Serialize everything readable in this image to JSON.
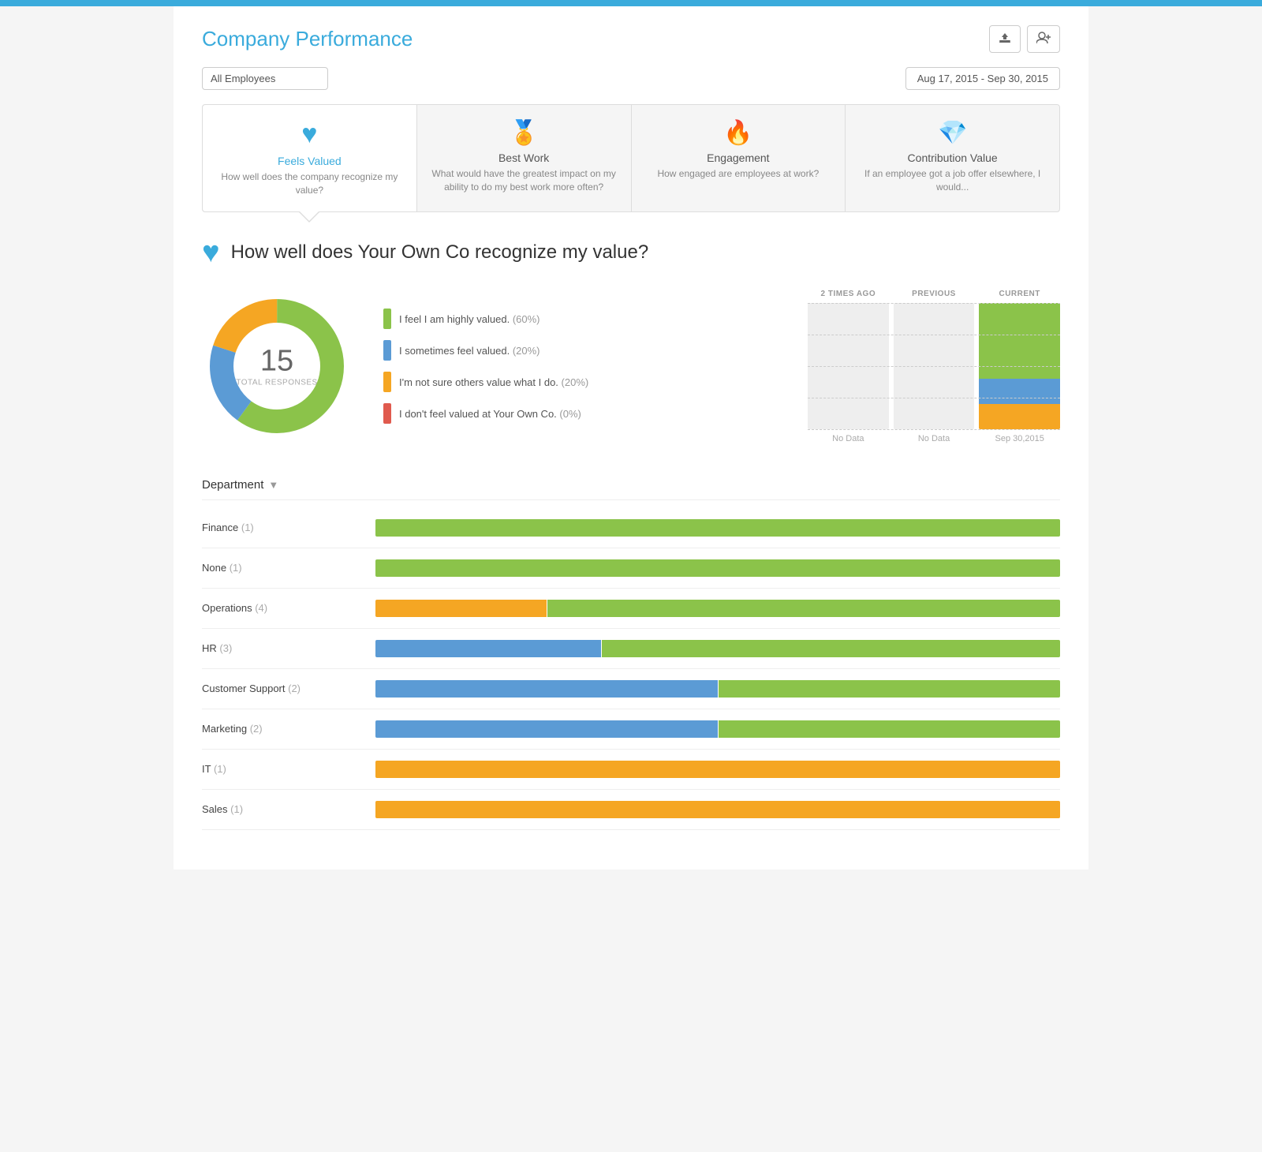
{
  "topBar": {
    "color": "#3aabdc"
  },
  "header": {
    "title": "Company Performance",
    "exportBtn": "⬆",
    "addBtn": "👤+"
  },
  "filters": {
    "employee": "All Employees",
    "dateRange": "Aug 17, 2015 - Sep 30, 2015"
  },
  "tabs": [
    {
      "id": "feels-valued",
      "icon": "♥",
      "iconType": "heart",
      "title": "Feels Valued",
      "desc": "How well does the company recognize my value?",
      "active": true
    },
    {
      "id": "best-work",
      "icon": "🏅",
      "iconType": "badge",
      "title": "Best Work",
      "desc": "What would have the greatest impact on my ability to do my best work more often?",
      "active": false
    },
    {
      "id": "engagement",
      "icon": "🔥",
      "iconType": "flame",
      "title": "Engagement",
      "desc": "How engaged are employees at work?",
      "active": false
    },
    {
      "id": "contribution-value",
      "icon": "💎",
      "iconType": "diamond",
      "title": "Contribution Value",
      "desc": "If an employee got a job offer elsewhere, I would...",
      "active": false
    }
  ],
  "question": {
    "text": "How well does Your Own Co recognize my value?",
    "totalResponses": 15,
    "totalLabel": "TOTAL RESPONSES"
  },
  "donut": {
    "segments": [
      {
        "label": "I feel I am highly valued.",
        "pct": 60,
        "color": "#8bc34a"
      },
      {
        "label": "I sometimes feel valued.",
        "pct": 20,
        "color": "#5b9bd5"
      },
      {
        "label": "I'm not sure others value what I do.",
        "pct": 20,
        "color": "#f5a623"
      },
      {
        "label": "I don't feel valued at Your Own Co.",
        "pct": 0,
        "color": "#e05a4e"
      }
    ]
  },
  "history": {
    "columns": [
      {
        "label": "2 TIMES AGO",
        "dateLabel": "No Data",
        "hasData": false,
        "bars": []
      },
      {
        "label": "PREVIOUS",
        "dateLabel": "No Data",
        "hasData": false,
        "bars": []
      },
      {
        "label": "CURRENT",
        "dateLabel": "Sep 30,2015",
        "hasData": true,
        "bars": [
          {
            "color": "#8bc34a",
            "pct": 60
          },
          {
            "color": "#5b9bd5",
            "pct": 20
          },
          {
            "color": "#f5a623",
            "pct": 20
          }
        ]
      }
    ]
  },
  "department": {
    "label": "Department",
    "rows": [
      {
        "name": "Finance",
        "count": 1,
        "bars": [
          {
            "color": "#8bc34a",
            "pct": 100
          }
        ]
      },
      {
        "name": "None",
        "count": 1,
        "bars": [
          {
            "color": "#8bc34a",
            "pct": 100
          }
        ]
      },
      {
        "name": "Operations",
        "count": 4,
        "bars": [
          {
            "color": "#f5a623",
            "pct": 25
          },
          {
            "color": "#8bc34a",
            "pct": 75
          }
        ]
      },
      {
        "name": "HR",
        "count": 3,
        "bars": [
          {
            "color": "#5b9bd5",
            "pct": 33
          },
          {
            "color": "#8bc34a",
            "pct": 67
          }
        ]
      },
      {
        "name": "Customer Support",
        "count": 2,
        "bars": [
          {
            "color": "#5b9bd5",
            "pct": 50
          },
          {
            "color": "#8bc34a",
            "pct": 50
          }
        ]
      },
      {
        "name": "Marketing",
        "count": 2,
        "bars": [
          {
            "color": "#5b9bd5",
            "pct": 50
          },
          {
            "color": "#8bc34a",
            "pct": 50
          }
        ]
      },
      {
        "name": "IT",
        "count": 1,
        "bars": [
          {
            "color": "#f5a623",
            "pct": 100
          }
        ]
      },
      {
        "name": "Sales",
        "count": 1,
        "bars": [
          {
            "color": "#f5a623",
            "pct": 100
          }
        ]
      }
    ]
  }
}
